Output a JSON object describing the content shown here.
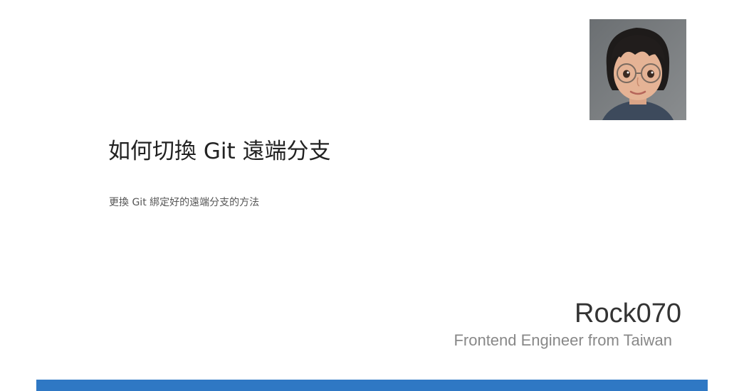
{
  "slide": {
    "title": "如何切換 Git 遠端分支",
    "subtitle": "更換 Git 綁定好的遠端分支的方法"
  },
  "author": {
    "name": "Rock070",
    "role": "Frontend Engineer from Taiwan",
    "avatar_icon": "cartoon-portrait-avatar"
  },
  "theme": {
    "accent_color": "#2f78c4"
  }
}
